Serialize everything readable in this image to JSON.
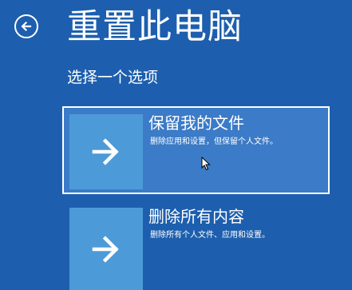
{
  "header": {
    "back_icon": "back-arrow-circle-icon",
    "title": "重置此电脑"
  },
  "subtitle": "选择一个选项",
  "options": [
    {
      "title": "保留我的文件",
      "description": "删除应用和设置，但保留个人文件。",
      "icon": "arrow-right-icon",
      "selected": true
    },
    {
      "title": "删除所有内容",
      "description": "删除所有个人文件、应用和设置。",
      "icon": "arrow-right-icon",
      "selected": false
    }
  ],
  "colors": {
    "background": "#1d5fae",
    "selected_background": "#3b7bc7",
    "tile": "#4d9ad8",
    "text": "#ffffff"
  }
}
